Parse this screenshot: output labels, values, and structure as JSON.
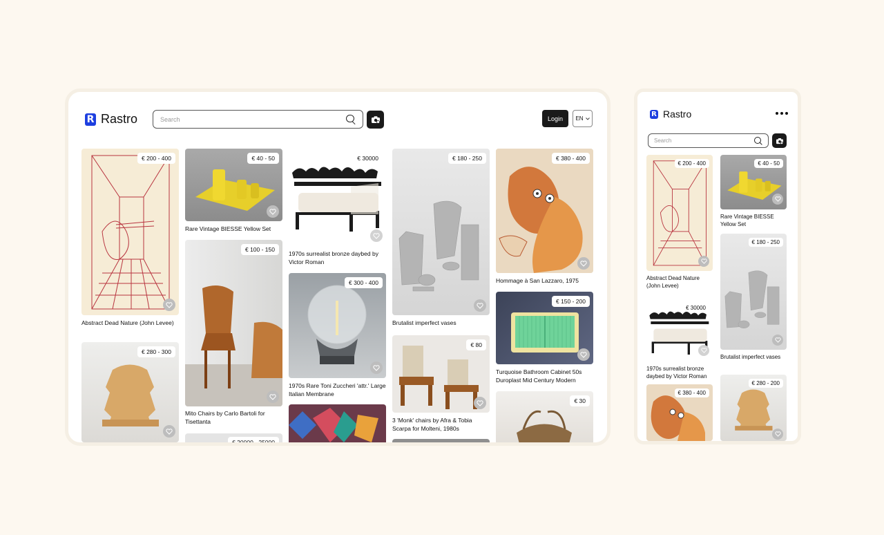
{
  "brand": {
    "mark": "R",
    "name": "Rastro",
    "color": "#1d3fe0"
  },
  "search": {
    "placeholder": "Search",
    "value": ""
  },
  "header": {
    "login_label": "Login",
    "language": "EN"
  },
  "desktop_cards": [
    {
      "price": "€ 200 - 400",
      "title": "Abstract Dead Nature (John Levee)",
      "image": "red ink corridor drawing"
    },
    {
      "price": "€ 280 - 300",
      "title": "",
      "image": "fibreglass lamp"
    },
    {
      "price": "€ 40 - 50",
      "title": "Rare Vintage BIESSE Yellow  Set",
      "image": "yellow tray set"
    },
    {
      "price": "€ 100 - 150",
      "title": "Mito Chairs by Carlo Bartoli for Tisettanta",
      "image": "bent plywood chairs"
    },
    {
      "price": "€ 20000 - 25000",
      "title": "",
      "image": ""
    },
    {
      "price": "€ 30000",
      "title": "1970s surrealist bronze daybed by Victor Roman",
      "image": "bronze daybed"
    },
    {
      "price": "€ 300 - 400",
      "title": "1970s Rare Toni Zuccheri 'attr.' Large Italian Membrane",
      "image": "glass globe lamp"
    },
    {
      "price": "",
      "title": "",
      "image": "colorful abstract painting"
    },
    {
      "price": "€ 180 - 250",
      "title": "Brutalist imperfect vases",
      "image": "aluminium vases"
    },
    {
      "price": "€ 80",
      "title": "3 'Monk' chairs by Afra & Tobia Scarpa for Molteni, 1980s",
      "image": "monk chairs"
    },
    {
      "price": "€ 380 - 400",
      "title": "Hommage à San Lazzaro, 1975",
      "image": "orange painting"
    },
    {
      "price": "€ 150 - 200",
      "title": "Turquoise Bathroom Cabinet 50s Duroplast Mid Century Modern",
      "image": "green cabinet"
    },
    {
      "price": "€ 30",
      "title": "",
      "image": "wicker basket"
    }
  ],
  "mobile_cards": [
    {
      "price": "€ 200 - 400",
      "title": "Abstract Dead Nature (John Levee)"
    },
    {
      "price": "€ 30000",
      "title": "1970s surrealist bronze daybed by Victor Roman"
    },
    {
      "price": "€ 380 - 400",
      "title": ""
    },
    {
      "price": "€ 40 - 50",
      "title": "Rare Vintage BIESSE Yellow  Set"
    },
    {
      "price": "€ 180 - 250",
      "title": "Brutalist imperfect vases"
    },
    {
      "price": "€ 280 - 200",
      "title": ""
    }
  ]
}
